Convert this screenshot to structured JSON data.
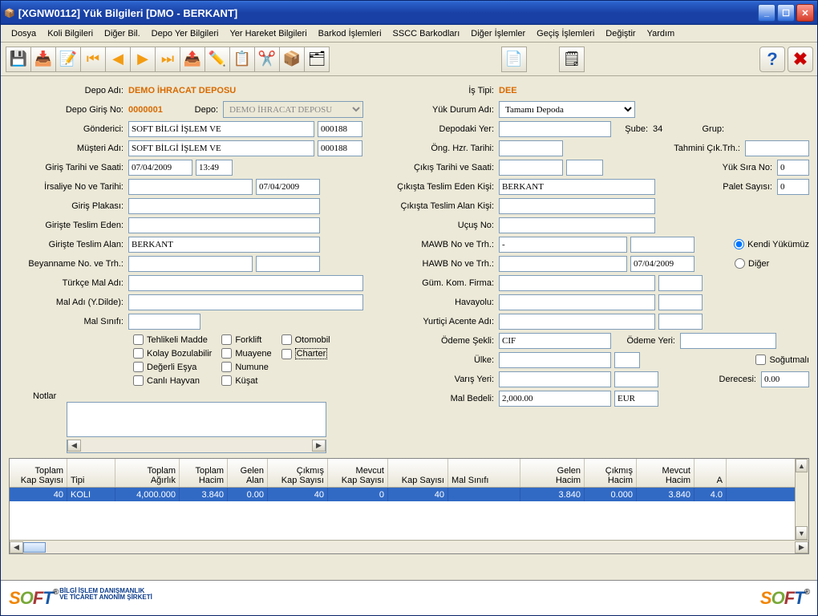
{
  "title": "[XGNW0112] Yük Bilgileri [DMO - BERKANT]",
  "menu": [
    "Dosya",
    "Koli Bilgileri",
    "Diğer Bil.",
    "Depo Yer Bilgileri",
    "Yer Hareket Bilgileri",
    "Barkod İşlemleri",
    "SSCC Barkodları",
    "Diğer İşlemler",
    "Geçiş İşlemleri",
    "Değiştir",
    "Yardım"
  ],
  "labels": {
    "depoAdi": "Depo Adı:",
    "depoGirisNo": "Depo Giriş No:",
    "depo": "Depo:",
    "gonderici": "Gönderici:",
    "musteriAdi": "Müşteri Adı:",
    "girisTarihi": "Giriş Tarihi ve Saati:",
    "irsaliye": "İrsaliye No ve Tarihi:",
    "girisPlaka": "Giriş Plakası:",
    "giristeTeslimEden": "Girişte Teslim Eden:",
    "giristeTeslimAlan": "Girişte Teslim Alan:",
    "beyanname": "Beyanname No. ve Trh.:",
    "turkceMal": "Türkçe Mal Adı:",
    "malYdilde": "Mal Adı (Y.Dilde):",
    "malSinifi": "Mal Sınıfı:",
    "isTipi": "İş Tipi:",
    "yukDurum": "Yük Durum Adı:",
    "depodakiYer": "Depodaki Yer:",
    "sube": "Şube:",
    "grup": "Grup:",
    "ongHzr": "Öng. Hzr. Tarihi:",
    "tahminiCik": "Tahmini Çık.Trh.:",
    "cikisTarihi": "Çıkış Tarihi ve Saati:",
    "yukSiraNo": "Yük Sıra No:",
    "cikistaTeslimEden": "Çıkışta Teslim Eden Kişi:",
    "paletSayisi": "Palet Sayısı:",
    "cikistaTeslimAlan": "Çıkışta Teslim Alan Kişi:",
    "ucusNo": "Uçuş No:",
    "mawb": "MAWB No ve Trh.:",
    "hawb": "HAWB No ve Trh.:",
    "gumKom": "Güm. Kom. Firma:",
    "havayolu": "Havayolu:",
    "yurticiAcente": "Yurtiçi Acente Adı:",
    "odemeSekli": "Ödeme Şekli:",
    "odemeYeri": "Ödeme Yeri:",
    "ulke": "Ülke:",
    "sogutmali": "Soğutmalı",
    "varisYeri": "Varış Yeri:",
    "derecesi": "Derecesi:",
    "malBedeli": "Mal Bedeli:",
    "kendiYuk": "Kendi Yükümüz",
    "diger": "Diğer",
    "notlar": "Notlar"
  },
  "checks": {
    "tehlikeli": "Tehlikeli Madde",
    "kolay": "Kolay Bozulabilir",
    "degerli": "Değerli Eşya",
    "canli": "Canlı Hayvan",
    "forklift": "Forklift",
    "muayene": "Muayene",
    "numune": "Numune",
    "kusat": "Küşat",
    "otomobil": "Otomobil",
    "charter": "Charter"
  },
  "values": {
    "depoAdi": "DEMO İHRACAT DEPOSU",
    "depoGirisNo": "0000001",
    "depoSelect": "DEMO İHRACAT DEPOSU",
    "gonderici": "SOFT BİLGİ İŞLEM VE",
    "gondericiKod": "000188",
    "musteriAdi": "SOFT BİLGİ İŞLEM VE",
    "musteriKod": "000188",
    "girisTarihi": "07/04/2009",
    "girisSaati": "13:49",
    "irsaliyeTarih": "07/04/2009",
    "giristeTeslimAlan": "BERKANT",
    "isTipi": "DEE",
    "yukDurum": "Tamamı Depoda",
    "sube": "34",
    "cikistaTeslimEden": "BERKANT",
    "yukSiraNo": "0",
    "paletSayisi": "0",
    "mawbNo": "-",
    "hawbTarih": "07/04/2009",
    "odemeSekli": "CIF",
    "malBedeli": "2,000.00",
    "malBedeliDoviz": "EUR",
    "derecesi": "0.00"
  },
  "grid": {
    "headers": [
      "Toplam\nKap Sayısı",
      "Tipi",
      "Toplam\nAğırlık",
      "Toplam\nHacim",
      "Gelen\nAlan",
      "Çıkmış\nKap Sayısı",
      "Mevcut\nKap Sayısı",
      "Kap Sayısı",
      "Mal Sınıfı",
      "Gelen\nHacim",
      "Çıkmış\nHacim",
      "Mevcut\nHacim",
      "A"
    ],
    "row": [
      "40",
      "KOLI",
      "4,000.000",
      "3.840",
      "0.00",
      "40",
      "0",
      "40",
      "",
      "3.840",
      "0.000",
      "3.840",
      "4.0"
    ]
  },
  "logoSub": "BİLGİ İŞLEM DANIŞMANLIK\nVE TİCARET ANONİM ŞİRKETİ"
}
